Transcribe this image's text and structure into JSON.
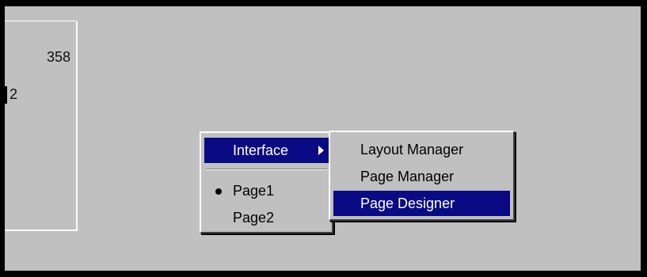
{
  "background_panel": {
    "top_value": "358",
    "mid_value": "2"
  },
  "context_menu": {
    "items": [
      {
        "label": "Interface",
        "highlighted": true,
        "has_submenu": true
      },
      {
        "label": "Page1",
        "checked": true
      },
      {
        "label": "Page2",
        "checked": false
      }
    ]
  },
  "submenu": {
    "items": [
      {
        "label": "Layout Manager"
      },
      {
        "label": "Page Manager"
      },
      {
        "label": "Page Designer",
        "highlighted": true
      }
    ]
  },
  "colors": {
    "face": "#c0c0c0",
    "highlight": "#0a0a84",
    "frame": "#000000"
  }
}
